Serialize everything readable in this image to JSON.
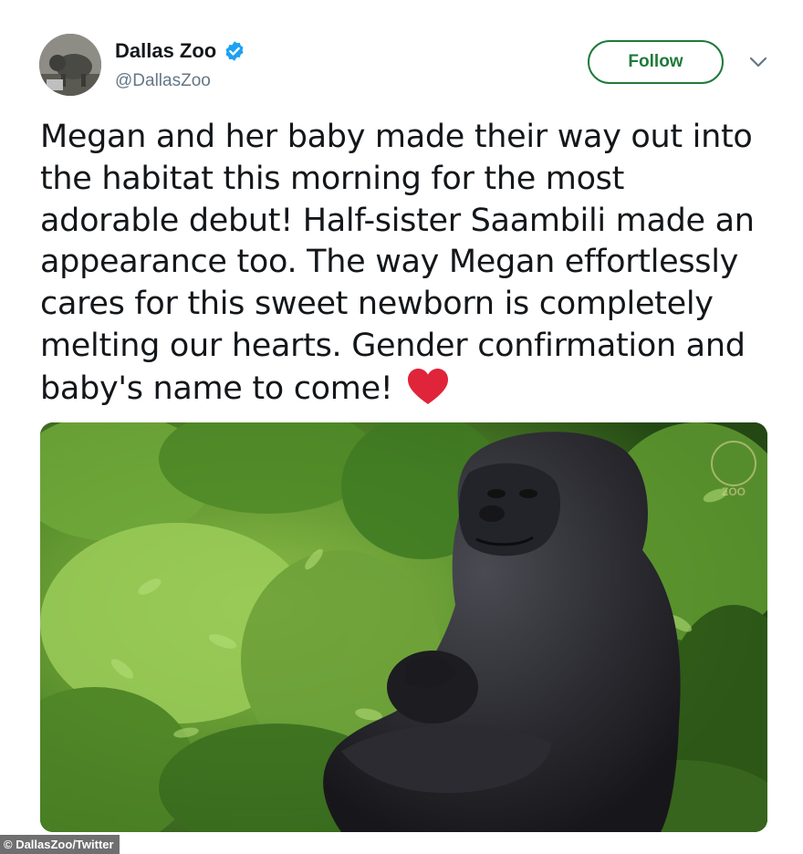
{
  "tweet": {
    "display_name": "Dallas Zoo",
    "handle": "@DallasZoo",
    "verified": true,
    "follow_label": "Follow",
    "text_lines": [
      "Megan and her baby made their way out into",
      "the habitat this morning for the most",
      "adorable debut! Half-sister Saambili made an",
      "appearance too. The way Megan effortlessly",
      "cares for this sweet newborn is completely",
      "melting our hearts. Gender confirmation and",
      "baby's name to come!"
    ],
    "emoji": "red-heart",
    "media": {
      "watermark": "ZOO"
    }
  },
  "credit": "© DallasZoo/Twitter",
  "colors": {
    "follow": "#1f7a3a",
    "verified": "#1da1f2",
    "handle": "#657786",
    "heart": "#e0243a"
  },
  "icons": {
    "verified": "verified-badge-icon",
    "caret": "chevron-down-icon",
    "heart": "red-heart-emoji"
  }
}
